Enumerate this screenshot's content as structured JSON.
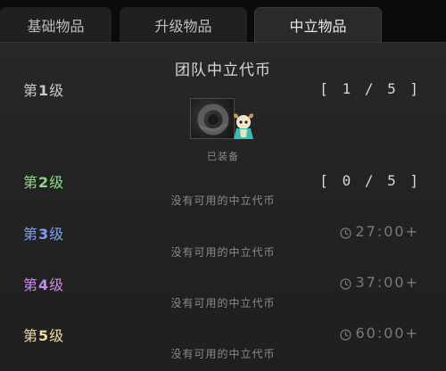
{
  "tabs": [
    {
      "label": "基础物品",
      "active": false
    },
    {
      "label": "升级物品",
      "active": false
    },
    {
      "label": "中立物品",
      "active": true
    }
  ],
  "panel": {
    "title": "团队中立代币",
    "tiers": [
      {
        "prefix": "第",
        "number": "1",
        "suffix": "级",
        "color": "#c8c8c8",
        "status": "[ 1 / 5 ]",
        "equipped_label": "已装备"
      },
      {
        "prefix": "第",
        "number": "2",
        "suffix": "级",
        "color": "#8fd98a",
        "status": "[ 0 / 5 ]",
        "empty_text": "没有可用的中立代币"
      },
      {
        "prefix": "第",
        "number": "3",
        "suffix": "级",
        "color": "#7f9ff0",
        "timer": "27:00+",
        "empty_text": "没有可用的中立代币"
      },
      {
        "prefix": "第",
        "number": "4",
        "suffix": "级",
        "color": "#c98af0",
        "timer": "37:00+",
        "empty_text": "没有可用的中立代币"
      },
      {
        "prefix": "第",
        "number": "5",
        "suffix": "级",
        "color": "#f0d8a0",
        "timer": "60:00+",
        "empty_text": "没有可用的中立代币"
      }
    ]
  },
  "icons": {
    "clock": "clock-icon",
    "item": "neutral-token-icon",
    "hero": "hero-portrait-icon"
  }
}
